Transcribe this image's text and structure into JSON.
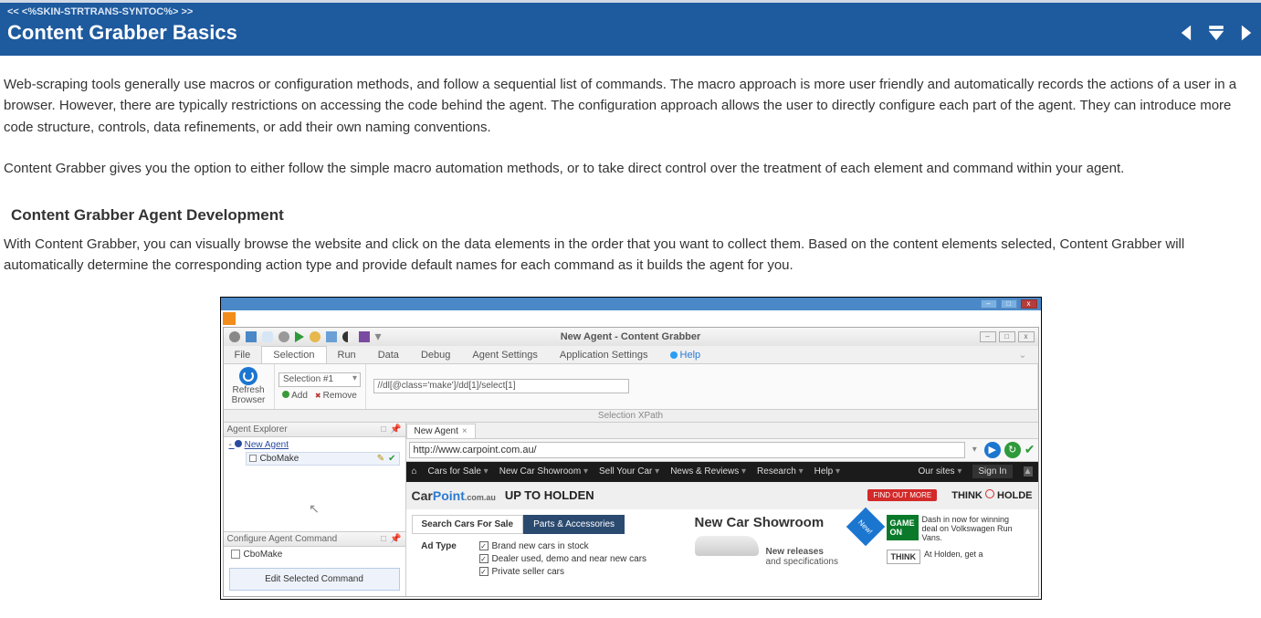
{
  "breadcrumb": "<< <%SKIN-STRTRANS-SYNTOC%> >>",
  "page_title": "Content Grabber Basics",
  "para1": "Web-scraping tools generally use macros or configuration methods, and follow a sequential list of commands. The macro approach is more user friendly and automatically records the actions of a user in a browser. However, there are typically restrictions on accessing the code behind the agent. The configuration approach allows the user to directly configure each part of the agent. They can introduce more code structure, controls, data refinements, or add their own naming conventions.",
  "para2": "Content Grabber gives you the option to either follow the simple macro automation methods, or to take direct control over the treatment of each element and command within your agent.",
  "subhead": "Content Grabber Agent Development",
  "para3": "With Content Grabber, you can visually browse the website and click on the data elements in the order that you want to collect them. Based on the content elements selected, Content Grabber will automatically determine the corresponding action type and provide default names for each command as it builds the agent for you.",
  "app": {
    "title": "New Agent - Content Grabber",
    "tabs": {
      "file": "File",
      "selection": "Selection",
      "run": "Run",
      "data": "Data",
      "debug": "Debug",
      "agent_settings": "Agent Settings",
      "application_settings": "Application Settings",
      "help": "Help"
    },
    "ribbon": {
      "refresh_label": "Refresh Browser",
      "selection_value": "Selection #1",
      "add": "Add",
      "remove": "Remove",
      "xpath_text": "//dl[@class='make']/dd[1]/select[1]",
      "xpath_label": "Selection XPath"
    },
    "explorer": {
      "header": "Agent Explorer",
      "root": "New Agent",
      "child": "CboMake"
    },
    "configure": {
      "header": "Configure Agent Command",
      "chk": "CboMake",
      "btn": "Edit Selected Command"
    },
    "doc_tab": "New Agent",
    "url": "http://www.carpoint.com.au/",
    "site_nav": {
      "cars": "Cars for Sale",
      "showroom": "New Car Showroom",
      "sell": "Sell Your Car",
      "news": "News & Reviews",
      "research": "Research",
      "help": "Help",
      "oursites": "Our sites",
      "signin": "Sign In"
    },
    "brand": {
      "car": "Car",
      "point": "Point",
      "dom": ".com.au",
      "slogan": "UP TO HOLDEN",
      "findout": "FIND OUT MORE",
      "think_pre": "THINK",
      "think_post": "HOLDE"
    },
    "search_tabs": {
      "sale": "Search Cars For Sale",
      "parts": "Parts & Accessories"
    },
    "adtype_label": "Ad Type",
    "ad_opts": {
      "o1": "Brand new cars in stock",
      "o2": "Dealer used, demo and near new cars",
      "o3": "Private seller cars"
    },
    "showroom": {
      "title": "New Car Showroom",
      "new": "New!",
      "sub1": "New releases",
      "sub2": "and specifications"
    },
    "promo": {
      "txt1": "Dash in now for winning deal on Volkswagen Run Vans.",
      "badge1": "GAME ON",
      "txt2": "At Holden, get a",
      "badge2": "THINK"
    }
  }
}
